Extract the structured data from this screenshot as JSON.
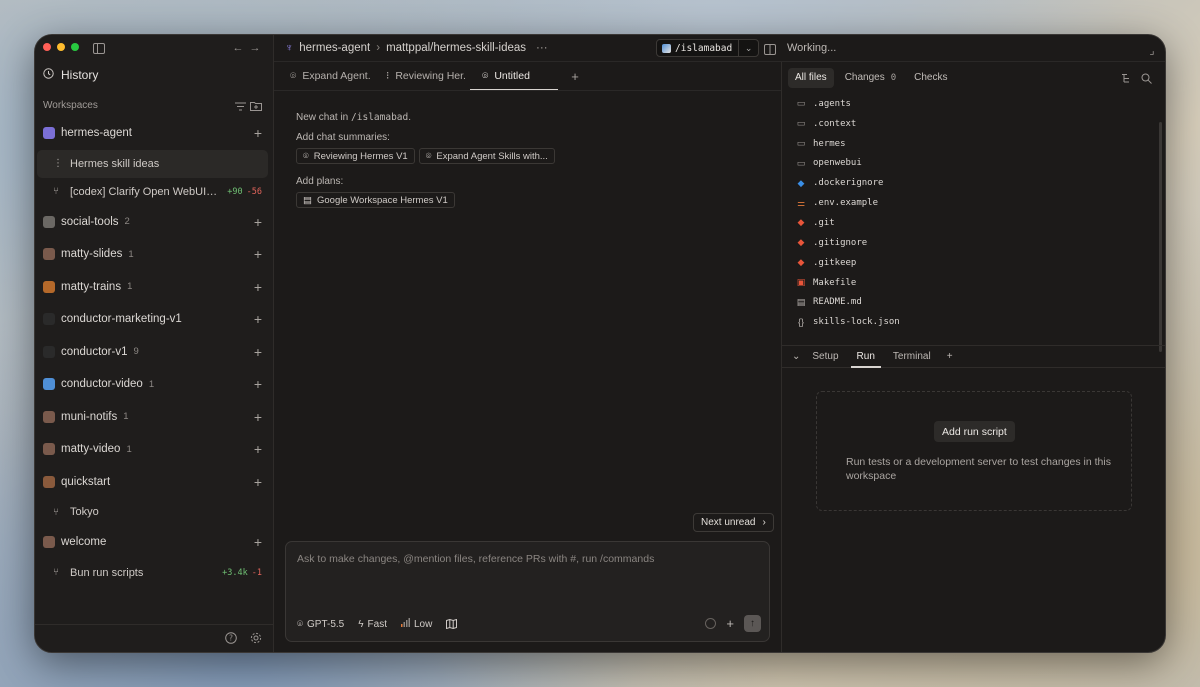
{
  "sidebar": {
    "history_label": "History",
    "workspaces_label": "Workspaces",
    "workspaces": [
      {
        "name": "hermes-agent",
        "count": "",
        "icon_color": "#7b6fd6",
        "icon": "hermes-icon",
        "children": [
          {
            "name": "Hermes skill ideas",
            "glyph": "⋮",
            "active": true,
            "add": "",
            "del": ""
          },
          {
            "name": "[codex] Clarify Open WebUI Ol...",
            "glyph": "⑂",
            "active": false,
            "add": "+90",
            "del": "-56"
          }
        ]
      },
      {
        "name": "social-tools",
        "count": "2",
        "icon_color": "#6b6864",
        "icon": "gamepad-icon",
        "children": []
      },
      {
        "name": "matty-slides",
        "count": "1",
        "icon_color": "#7a5a4c",
        "icon": "avatar-icon",
        "children": []
      },
      {
        "name": "matty-trains",
        "count": "1",
        "icon_color": "#b5692a",
        "icon": "train-icon",
        "children": []
      },
      {
        "name": "conductor-marketing-v1",
        "count": "",
        "icon_color": "#2a2a2a",
        "icon": "conductor-icon",
        "children": []
      },
      {
        "name": "conductor-v1",
        "count": "9",
        "icon_color": "#2a2a2a",
        "icon": "conductor-icon",
        "children": []
      },
      {
        "name": "conductor-video",
        "count": "1",
        "icon_color": "#4f8fd6",
        "icon": "video-icon",
        "children": []
      },
      {
        "name": "muni-notifs",
        "count": "1",
        "icon_color": "#7a5a4c",
        "icon": "avatar-icon",
        "children": []
      },
      {
        "name": "matty-video",
        "count": "1",
        "icon_color": "#7a5a4c",
        "icon": "avatar-icon",
        "children": []
      },
      {
        "name": "quickstart",
        "count": "",
        "icon_color": "#8a5a3c",
        "icon": "quickstart-icon",
        "children": [
          {
            "name": "Tokyo",
            "glyph": "⑂",
            "active": false,
            "add": "",
            "del": ""
          }
        ]
      },
      {
        "name": "welcome",
        "count": "",
        "icon_color": "#7a5a4c",
        "icon": "avatar-icon",
        "children": [
          {
            "name": "Bun run scripts",
            "glyph": "⑂",
            "active": false,
            "add": "+3.4k",
            "del": "-1"
          }
        ]
      }
    ]
  },
  "topbar": {
    "repo": "hermes-agent",
    "branch_path": "mattppal/hermes-skill-ideas",
    "more": "···",
    "workspace_dir": "/islamabad",
    "status": "Working..."
  },
  "tabs": [
    {
      "label": "Expand Agent...",
      "icon": "⌾",
      "active": false
    },
    {
      "label": "Reviewing Her...",
      "icon": "⁝",
      "active": false
    },
    {
      "label": "Untitled",
      "icon": "⌾",
      "active": true
    }
  ],
  "chat": {
    "new_chat_prefix": "New chat in ",
    "new_chat_dir": "/islamabad",
    "new_chat_suffix": ".",
    "summaries_label": "Add chat summaries:",
    "summaries": [
      "Reviewing Hermes V1",
      "Expand Agent Skills with..."
    ],
    "plans_label": "Add plans:",
    "plans": [
      "Google Workspace Hermes V1"
    ],
    "next_unread": "Next unread"
  },
  "composer": {
    "placeholder": "Ask to make changes, @mention files, reference PRs with #, run /commands",
    "model": "GPT-5.5",
    "speed": "Fast",
    "effort": "Low"
  },
  "files_panel": {
    "tabs": [
      {
        "label": "All files",
        "count": "",
        "active": true
      },
      {
        "label": "Changes",
        "count": "0",
        "active": false
      },
      {
        "label": "Checks",
        "count": "",
        "active": false
      }
    ],
    "files": [
      {
        "name": ".agents",
        "icon": "folder-icon",
        "glyph": "▭",
        "color": "#9c9793"
      },
      {
        "name": ".context",
        "icon": "folder-icon",
        "glyph": "▭",
        "color": "#9c9793"
      },
      {
        "name": "hermes",
        "icon": "folder-icon",
        "glyph": "▭",
        "color": "#9c9793"
      },
      {
        "name": "openwebui",
        "icon": "folder-icon",
        "glyph": "▭",
        "color": "#9c9793"
      },
      {
        "name": ".dockerignore",
        "icon": "docker-icon",
        "glyph": "◆",
        "color": "#3a8ee6"
      },
      {
        "name": ".env.example",
        "icon": "settings-icon",
        "glyph": "⚌",
        "color": "#e07a3a"
      },
      {
        "name": ".git",
        "icon": "git-icon",
        "glyph": "◆",
        "color": "#e8553a"
      },
      {
        "name": ".gitignore",
        "icon": "git-icon",
        "glyph": "◆",
        "color": "#e8553a"
      },
      {
        "name": ".gitkeep",
        "icon": "git-icon",
        "glyph": "◆",
        "color": "#e8553a"
      },
      {
        "name": "Makefile",
        "icon": "makefile-icon",
        "glyph": "▣",
        "color": "#e8553a"
      },
      {
        "name": "README.md",
        "icon": "markdown-icon",
        "glyph": "▤",
        "color": "#b8b3af"
      },
      {
        "name": "skills-lock.json",
        "icon": "json-icon",
        "glyph": "{}",
        "color": "#b8b3af"
      }
    ]
  },
  "run_panel": {
    "tabs": [
      {
        "label": "Setup",
        "active": false
      },
      {
        "label": "Run",
        "active": true
      },
      {
        "label": "Terminal",
        "active": false
      }
    ],
    "add_button": "Add run script",
    "description": "Run tests or a development server to test changes in this workspace"
  }
}
